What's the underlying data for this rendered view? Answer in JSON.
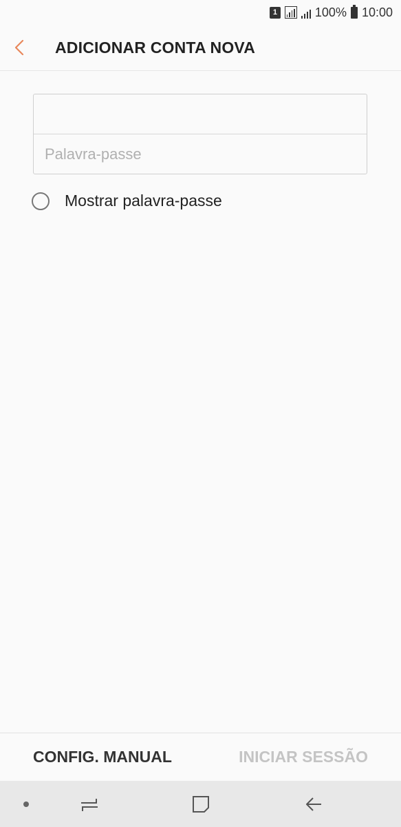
{
  "status_bar": {
    "sim_label": "1",
    "battery_percent": "100%",
    "time": "10:00"
  },
  "header": {
    "title": "ADICIONAR CONTA NOVA",
    "back_icon": "chevron-left-icon",
    "accent_color": "#e8875a"
  },
  "form": {
    "email_value": "",
    "email_placeholder": "",
    "password_value": "",
    "password_placeholder": "Palavra-passe"
  },
  "show_password": {
    "label": "Mostrar palavra-passe",
    "checked": false
  },
  "actions": {
    "manual_label": "CONFIG. MANUAL",
    "signin_label": "INICIAR SESSÃO"
  },
  "nav": {
    "icons": [
      "dot-icon",
      "recents-icon",
      "home-icon",
      "back-arrow-icon"
    ]
  }
}
